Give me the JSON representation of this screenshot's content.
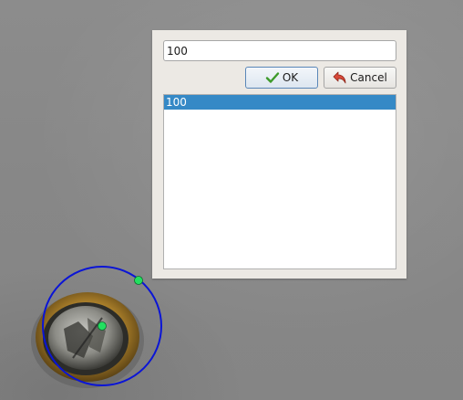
{
  "dialog": {
    "input": {
      "value": "100",
      "placeholder": ""
    },
    "buttons": {
      "ok_label": "OK",
      "ok_icon": "checkmark-icon",
      "cancel_label": "Cancel",
      "cancel_icon": "undo-arrow-icon"
    },
    "list": {
      "items": [
        {
          "label": "100",
          "selected": true
        }
      ]
    }
  },
  "overlay": {
    "circle_color": "#0a14d6",
    "handle_color": "#22e060",
    "background_object": "coin"
  },
  "colors": {
    "selection": "#3589c6",
    "dialog_background": "#ece9e4"
  }
}
